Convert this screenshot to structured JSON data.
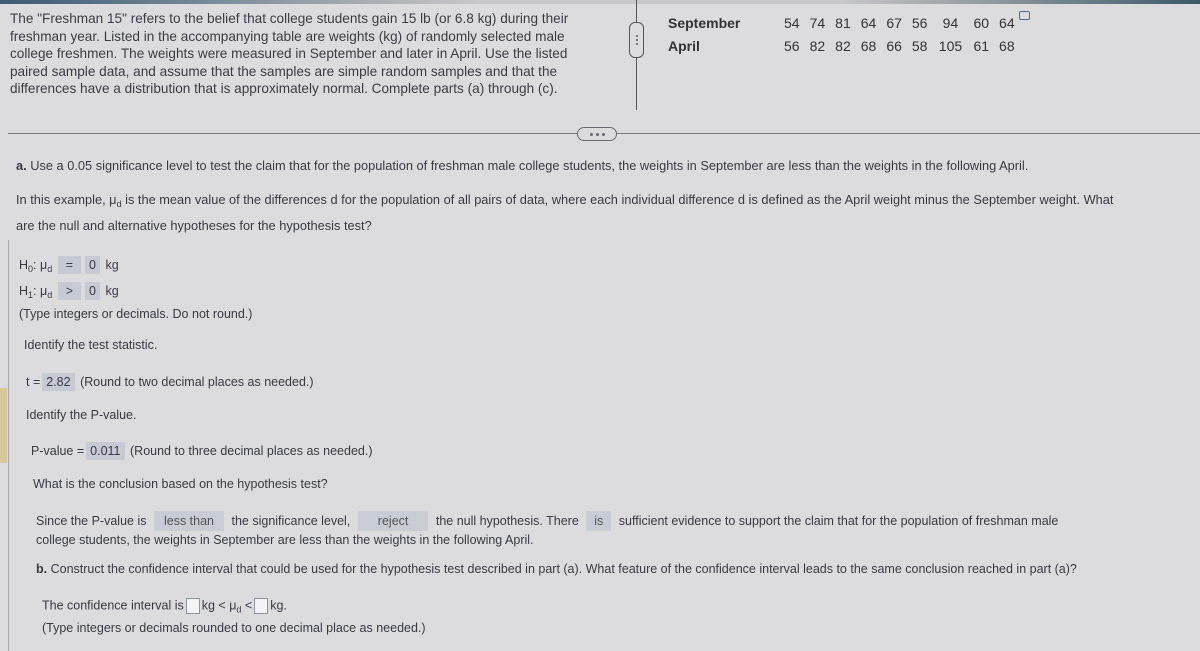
{
  "intro_text": "The \"Freshman 15\" refers to the belief that college students gain 15 lb (or 6.8 kg) during their freshman year. Listed in the accompanying table are weights (kg) of randomly selected male college freshmen. The weights were measured in September and later in April. Use the listed paired sample data, and assume that the samples are simple random samples and that the differences have a distribution that is approximately normal. Complete parts (a) through (c).",
  "table": {
    "rows": [
      {
        "label": "September",
        "values": [
          "54",
          "74",
          "81",
          "64",
          "67",
          "56",
          "94",
          "60",
          "64"
        ]
      },
      {
        "label": "April",
        "values": [
          "56",
          "82",
          "82",
          "68",
          "66",
          "58",
          "105",
          "61",
          "68"
        ]
      }
    ],
    "copy_icon": "copy-icon"
  },
  "part_a": {
    "prompt_label": "a.",
    "prompt": "Use a 0.05 significance level to test the claim that for the population of freshman male college students, the weights in September are less than the weights in the following April.",
    "context_1": "In this example, μ",
    "context_sub": "d",
    "context_2": " is the mean value of the differences d for the population of all pairs of data, where each individual difference d is defined as the April weight minus the September weight. What",
    "context_3": "are the null and alternative hypotheses for the hypothesis test?",
    "h0": {
      "label": "H",
      "sub": "0",
      "mu": ": μ",
      "mu_sub": "d",
      "operator": "=",
      "value": "0",
      "unit": "kg"
    },
    "h1": {
      "label": "H",
      "sub": "1",
      "mu": ": μ",
      "mu_sub": "d",
      "operator": ">",
      "value": "0",
      "unit": "kg"
    },
    "hyp_hint": "(Type integers or decimals. Do not round.)",
    "test_stat_q": "Identify the test statistic.",
    "t_label": "t =",
    "t_value": "2.82",
    "t_hint": "(Round to two decimal places as needed.)",
    "pvalue_q": "Identify the P-value.",
    "pvalue_label": "P-value =",
    "pvalue_value": "0.011",
    "pvalue_hint": "(Round to three decimal places as needed.)",
    "conclusion_q": "What is the conclusion based on the hypothesis test?",
    "conclusion": {
      "s1": "Since the P-value is",
      "d1": "less than",
      "s2": "the significance level,",
      "d2": "reject",
      "s3": "the null hypothesis. There",
      "d3": "is",
      "s4": "sufficient evidence to support the claim that for the population of freshman male",
      "s5": "college students, the weights in September are less than the weights in the following April."
    }
  },
  "part_b": {
    "prompt_label": "b.",
    "prompt": "Construct the confidence interval that could be used for the hypothesis test described in part (a). What feature of the confidence interval leads to the same conclusion reached in part (a)?",
    "ci_prefix": "The confidence interval is",
    "ci_mid_1": "kg < μ",
    "ci_mid_sub": "d",
    "ci_mid_2": " <",
    "ci_suffix": "kg.",
    "ci_lower": "",
    "ci_upper": "",
    "ci_hint": "(Type integers or decimals rounded to one decimal place as needed.)"
  }
}
